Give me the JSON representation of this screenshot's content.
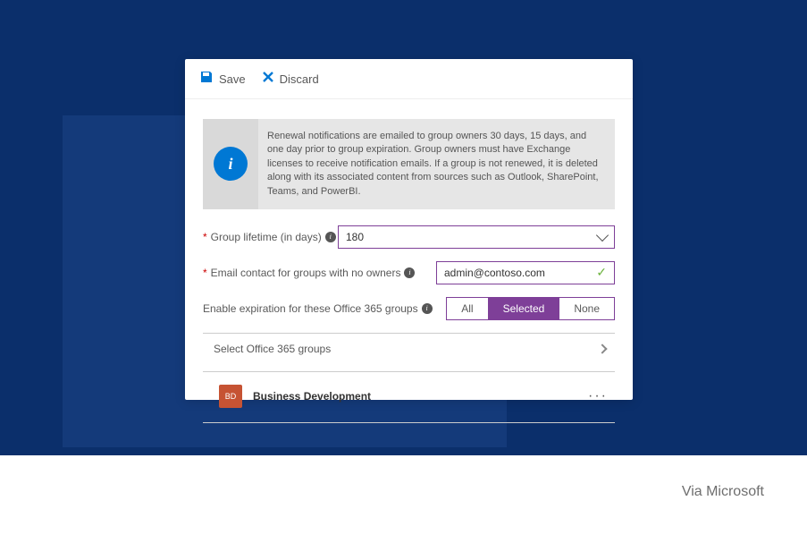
{
  "toolbar": {
    "save_label": "Save",
    "discard_label": "Discard"
  },
  "info": {
    "text": "Renewal notifications are emailed to group owners 30 days, 15 days, and one day prior to group expiration. Group owners must have Exchange licenses to receive notification emails. If a group is not renewed, it is deleted along with its associated content from sources such as Outlook, SharePoint, Teams, and PowerBI."
  },
  "form": {
    "lifetime_label": "Group lifetime (in days)",
    "lifetime_value": "180",
    "email_label": "Email contact for groups with no owners",
    "email_value": "admin@contoso.com",
    "enable_label": "Enable expiration for these Office 365 groups",
    "seg_all": "All",
    "seg_selected": "Selected",
    "seg_none": "None"
  },
  "select_groups_label": "Select Office 365 groups",
  "groups": [
    {
      "initials": "BD",
      "name": "Business Development"
    }
  ],
  "attribution": "Via Microsoft"
}
